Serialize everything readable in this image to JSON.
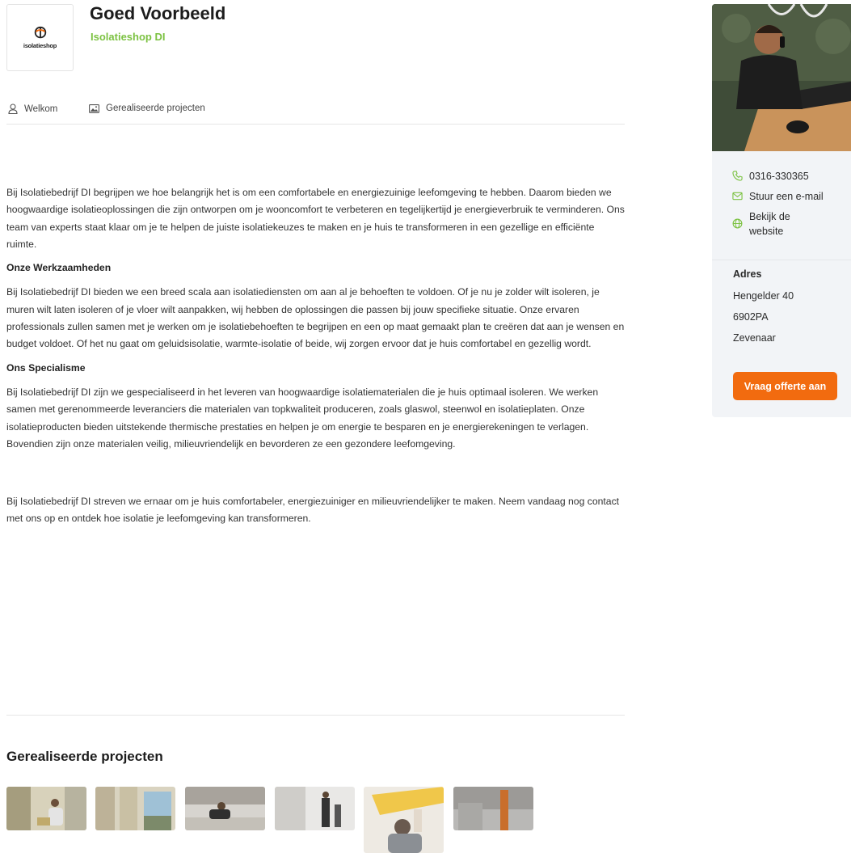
{
  "header": {
    "logo_text": "isolatieshop",
    "title": "Goed Voorbeeld",
    "subtitle": "Isolatieshop DI"
  },
  "tabs": [
    {
      "label": "Welkom",
      "icon": "user-icon"
    },
    {
      "label": "Gerealiseerde projecten",
      "icon": "image-icon"
    }
  ],
  "content": {
    "intro": "Bij Isolatiebedrijf DI begrijpen we hoe belangrijk het is om een comfortabele en energiezuinige leefomgeving te hebben. Daarom bieden we hoogwaardige isolatieoplossingen die zijn ontworpen om je wooncomfort te verbeteren en tegelijkertijd je energieverbruik te verminderen. Ons team van experts staat klaar om je te helpen de juiste isolatiekeuzes te maken en je huis te transformeren in een gezellige en efficiënte ruimte.",
    "section1_heading": "Onze Werkzaamheden",
    "section1_text": "Bij Isolatiebedrijf DI bieden we een breed scala aan isolatiediensten om aan al je behoeften te voldoen. Of je nu je zolder wilt isoleren, je muren wilt laten isoleren of je vloer wilt aanpakken, wij hebben de oplossingen die passen bij jouw specifieke situatie. Onze ervaren professionals zullen samen met je werken om je isolatiebehoeften te begrijpen en een op maat gemaakt plan te creëren dat aan je wensen en budget voldoet. Of het nu gaat om geluidsisolatie, warmte-isolatie of beide, wij zorgen ervoor dat je huis comfortabel en gezellig wordt.",
    "section2_heading": "Ons Specialisme",
    "section2_text": "Bij Isolatiebedrijf DI zijn we gespecialiseerd in het leveren van hoogwaardige isolatiematerialen die je huis optimaal isoleren. We werken samen met gerenommeerde leveranciers die materialen van topkwaliteit produceren, zoals glaswol, steenwol en isolatieplaten. Onze isolatieproducten bieden uitstekende thermische prestaties en helpen je om energie te besparen en je energierekeningen te verlagen. Bovendien zijn onze materialen veilig, milieuvriendelijk en bevorderen ze een gezondere leefomgeving.",
    "closing": "Bij Isolatiebedrijf DI streven we ernaar om je huis comfortabeler, energiezuiniger en milieuvriendelijker te maken. Neem vandaag nog contact met ons op en ontdek hoe isolatie je leefomgeving kan transformeren."
  },
  "projects": {
    "heading": "Gerealiseerde projecten",
    "thumb_count": 6
  },
  "sidebar": {
    "phone": "0316-330365",
    "email_label": "Stuur een e-mail",
    "website_label_1": "Bekijk de",
    "website_label_2": "website",
    "address_label": "Adres",
    "street": "Hengelder 40",
    "postcode": "6902PA",
    "city": "Zevenaar",
    "cta_label": "Vraag offerte aan"
  },
  "colors": {
    "brand_green": "#7cc242",
    "cta_orange": "#f26b0f",
    "sidebar_bg": "#f2f4f7"
  }
}
